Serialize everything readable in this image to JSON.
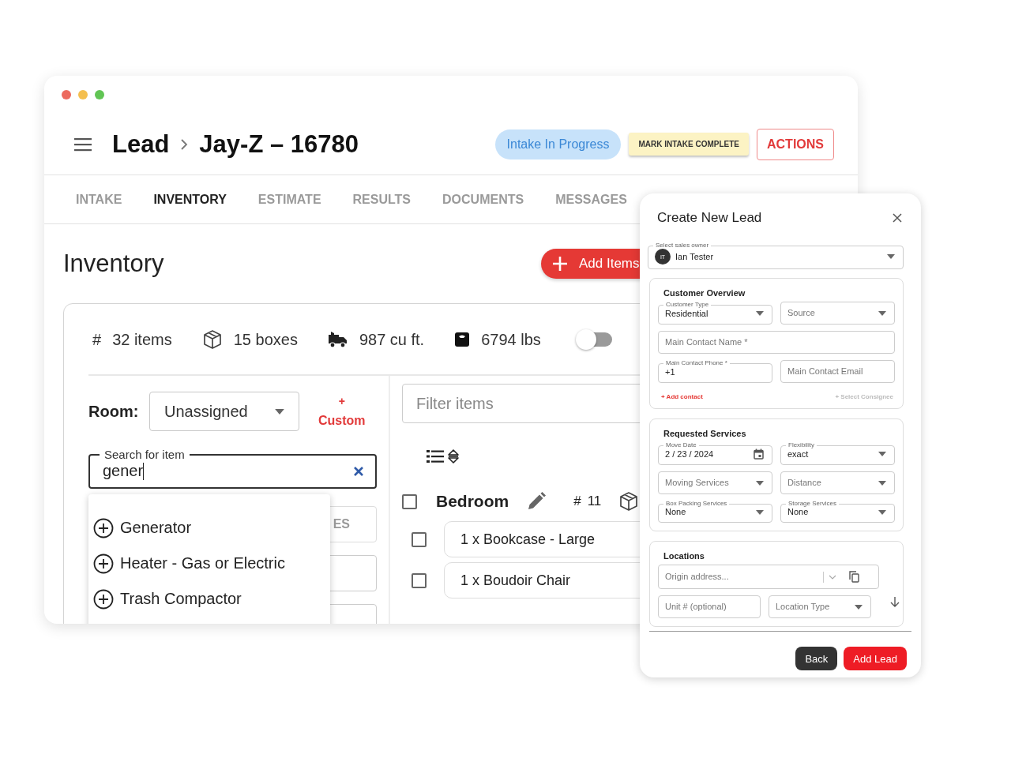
{
  "window": {
    "controls": [
      {
        "color": "#ec6a5e"
      },
      {
        "color": "#f4bf4f"
      },
      {
        "color": "#61c554"
      }
    ]
  },
  "breadcrumb": [
    "Lead",
    "Jay-Z – 16780"
  ],
  "status_pill": "Intake In Progress",
  "header_buttons": [
    {
      "label": "MARK INTAKE COMPLETE",
      "kind": "complete"
    },
    {
      "label": "ACTIONS",
      "kind": "actions"
    }
  ],
  "tabs": [
    {
      "label": "INTAKE",
      "selected": false
    },
    {
      "label": "INVENTORY",
      "selected": true
    },
    {
      "label": "ESTIMATE",
      "selected": false
    },
    {
      "label": "RESULTS",
      "selected": false
    },
    {
      "label": "DOCUMENTS",
      "selected": false
    },
    {
      "label": "MESSAGES",
      "selected": false
    }
  ],
  "page_title": "Inventory",
  "add_button": "Add Items",
  "stats": [
    {
      "kind": "count",
      "symbol": "#",
      "value": "32 items"
    },
    {
      "kind": "boxes",
      "value": "15 boxes"
    },
    {
      "kind": "volume",
      "value": "987 cu ft."
    },
    {
      "kind": "weight",
      "value": "6794 lbs"
    }
  ],
  "stats_toggle": {
    "on": false
  },
  "room": {
    "label": "Room:",
    "value": "Unassigned"
  },
  "custom_button": {
    "icon": "+",
    "label": "Custom"
  },
  "search": {
    "label": "Search for item",
    "value": "gener"
  },
  "suggestions": [
    "Generator",
    "Heater - Gas or Electric",
    "Trash Compactor"
  ],
  "covered_button": "ES",
  "filter": {
    "placeholder": "Filter items"
  },
  "room_group": {
    "name": "Bedroom",
    "checked": false,
    "count_symbol": "#",
    "count": "11",
    "items": [
      {
        "label": "1 x Bookcase - Large",
        "checked": false
      },
      {
        "label": "1 x Boudoir Chair",
        "checked": false
      }
    ]
  },
  "modal": {
    "title": "Create New Lead",
    "owner": {
      "label": "Select sales owner",
      "initials": "IT",
      "value": "Ian Tester"
    },
    "sections": [
      {
        "kind": "form",
        "title": "Customer Overview",
        "rows": [
          [
            {
              "kind": "select",
              "label": "Customer Type",
              "value": "Residential"
            },
            {
              "kind": "select",
              "placeholder": "Source"
            }
          ],
          [
            {
              "kind": "text",
              "placeholder": "Main Contact Name *"
            }
          ],
          [
            {
              "kind": "text",
              "label": "Main Contact Phone *",
              "value": "+1"
            },
            {
              "kind": "text",
              "placeholder": "Main Contact Email"
            }
          ]
        ],
        "links": [
          {
            "label": "+ Add contact",
            "disabled": false
          },
          {
            "label": "+ Select Consignee",
            "disabled": true
          }
        ]
      },
      {
        "kind": "form",
        "title": "Requested Services",
        "rows": [
          [
            {
              "kind": "date",
              "label": "Move Date",
              "value": "2 / 23 / 2024"
            },
            {
              "kind": "select",
              "label": "Flexibility",
              "value": "exact"
            }
          ],
          [
            {
              "kind": "select",
              "placeholder": "Moving Services"
            },
            {
              "kind": "select",
              "placeholder": "Distance"
            }
          ],
          [
            {
              "kind": "select",
              "label": "Box Packing Services",
              "value": "None"
            },
            {
              "kind": "select",
              "label": "Storage Services",
              "value": "None"
            }
          ]
        ]
      },
      {
        "kind": "locations",
        "title": "Locations",
        "rows": [
          [
            {
              "kind": "address",
              "placeholder": "Origin address..."
            }
          ],
          [
            {
              "kind": "text",
              "placeholder": "Unit # (optional)"
            },
            {
              "kind": "select",
              "placeholder": "Location Type"
            }
          ]
        ]
      }
    ],
    "buttons": [
      {
        "label": "Back",
        "kind": "secondary"
      },
      {
        "label": "Add Lead",
        "kind": "primary"
      }
    ]
  }
}
